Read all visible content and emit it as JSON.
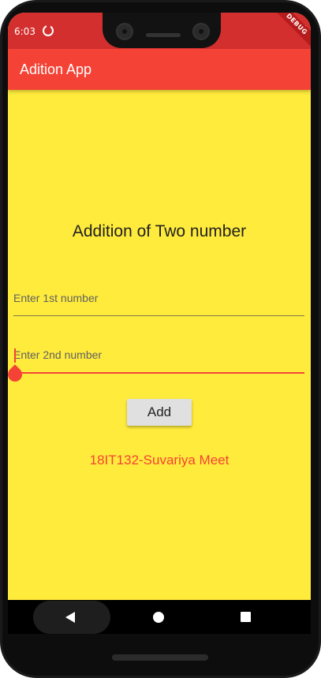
{
  "status_bar": {
    "time": "6:03",
    "debug_banner": "DEBUG"
  },
  "app_bar": {
    "title": "Adition App"
  },
  "main": {
    "heading": "Addition of Two number",
    "field1": {
      "placeholder": "Enter 1st number",
      "value": ""
    },
    "field2": {
      "placeholder": "Enter 2nd number",
      "value": ""
    },
    "add_button_label": "Add",
    "credit": "18IT132-Suvariya Meet"
  },
  "colors": {
    "background": "#FFEB3B",
    "app_bar": "#F44336",
    "status_bar": "#D32F2F",
    "accent": "#F44336"
  },
  "icons": [
    "sync-icon",
    "battery-icon",
    "back-icon",
    "home-icon",
    "recents-icon"
  ]
}
